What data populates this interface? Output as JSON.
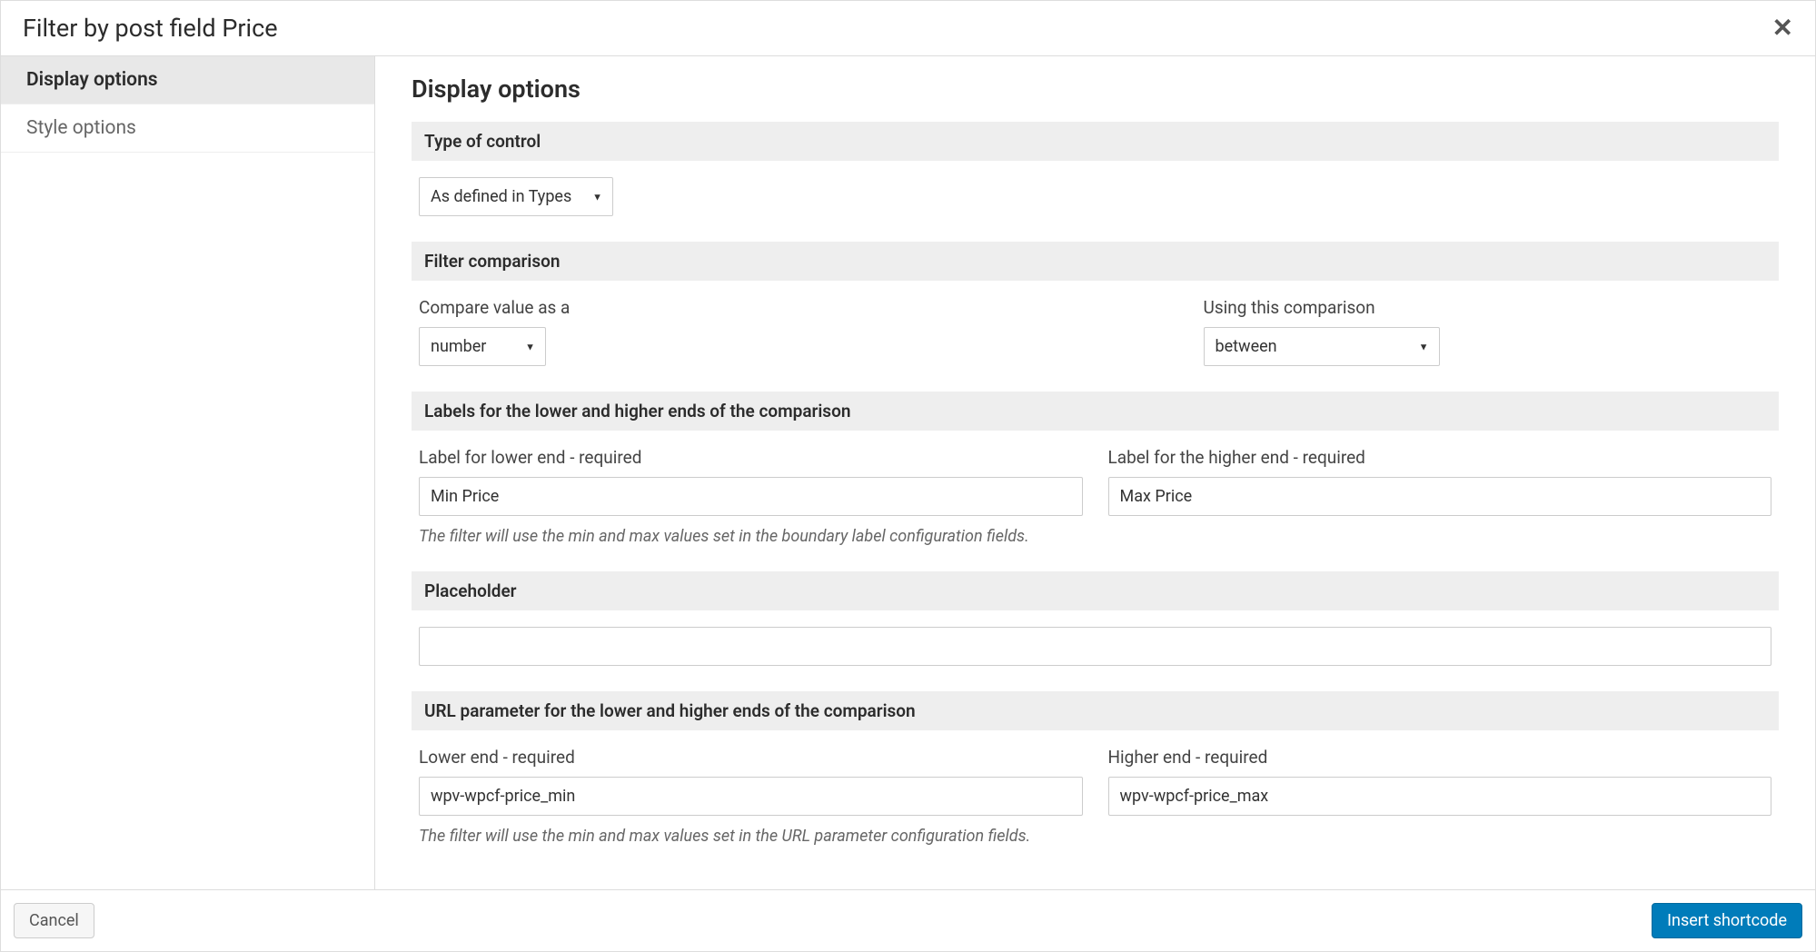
{
  "header": {
    "title": "Filter by post field Price"
  },
  "sidebar": {
    "items": [
      {
        "label": "Display options",
        "active": true
      },
      {
        "label": "Style options",
        "active": false
      }
    ]
  },
  "content": {
    "heading": "Display options",
    "sections": {
      "type_of_control": {
        "title": "Type of control",
        "select_value": "As defined in Types"
      },
      "filter_comparison": {
        "title": "Filter comparison",
        "compare_label": "Compare value as a",
        "compare_value": "number",
        "using_label": "Using this comparison",
        "using_value": "between"
      },
      "labels_ends": {
        "title": "Labels for the lower and higher ends of the comparison",
        "lower_label": "Label for lower end - required",
        "lower_value": "Min Price",
        "higher_label": "Label for the higher end - required",
        "higher_value": "Max Price",
        "hint": "The filter will use the min and max values set in the boundary label configuration fields."
      },
      "placeholder": {
        "title": "Placeholder",
        "value": ""
      },
      "url_param": {
        "title": "URL parameter for the lower and higher ends of the comparison",
        "lower_label": "Lower end - required",
        "lower_value": "wpv-wpcf-price_min",
        "higher_label": "Higher end - required",
        "higher_value": "wpv-wpcf-price_max",
        "hint": "The filter will use the min and max values set in the URL parameter configuration fields."
      }
    }
  },
  "footer": {
    "cancel_label": "Cancel",
    "submit_label": "Insert shortcode"
  }
}
